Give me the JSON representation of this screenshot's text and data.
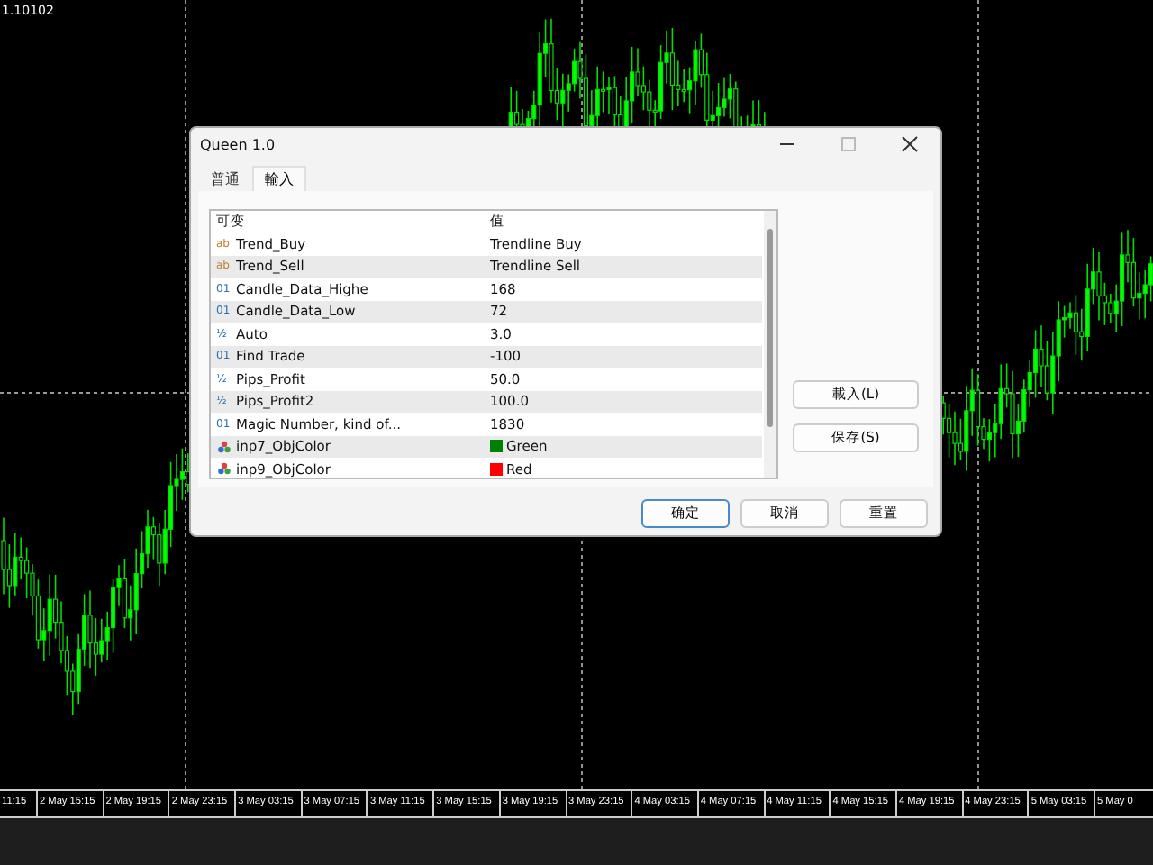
{
  "chart": {
    "price_label": "1.10102",
    "time_axis": [
      "11:15",
      "2 May 15:15",
      "2 May 19:15",
      "2 May 23:15",
      "3 May 03:15",
      "3 May 07:15",
      "3 May 11:15",
      "3 May 15:15",
      "3 May 19:15",
      "3 May 23:15",
      "4 May 03:15",
      "4 May 07:15",
      "4 May 11:15",
      "4 May 15:15",
      "4 May 19:15",
      "4 May 23:15",
      "5 May 03:15",
      "5 May 0"
    ]
  },
  "dialog": {
    "title": "Queen  1.0",
    "tabs": [
      {
        "label": "普通",
        "selected": false
      },
      {
        "label": "輸入",
        "selected": true
      }
    ],
    "table": {
      "columns": [
        "可变",
        "值"
      ],
      "rows": [
        {
          "kind": "string",
          "type_icon": "ab",
          "name": "Trend_Buy",
          "value": "Trendline Buy"
        },
        {
          "kind": "string",
          "type_icon": "ab",
          "name": "Trend_Sell",
          "value": "Trendline Sell"
        },
        {
          "kind": "int",
          "type_icon": "01",
          "name": "Candle_Data_Highe",
          "value": "168"
        },
        {
          "kind": "int",
          "type_icon": "01",
          "name": "Candle_Data_Low",
          "value": "72"
        },
        {
          "kind": "double",
          "type_icon": "½",
          "name": "Auto",
          "value": "3.0"
        },
        {
          "kind": "int",
          "type_icon": "01",
          "name": "Find Trade",
          "value": "-100"
        },
        {
          "kind": "double",
          "type_icon": "½",
          "name": "Pips_Profit",
          "value": "50.0"
        },
        {
          "kind": "double",
          "type_icon": "½",
          "name": "Pips_Profit2",
          "value": "100.0"
        },
        {
          "kind": "int",
          "type_icon": "01",
          "name": "Magic Number, kind of...",
          "value": "1830"
        },
        {
          "kind": "color",
          "name": "inp7_ObjColor",
          "value": "Green",
          "color": "#008000"
        },
        {
          "kind": "color",
          "name": "inp9_ObjColor",
          "value": "Red",
          "color": "#ff0000"
        }
      ]
    },
    "side_buttons": [
      "載入(L)",
      "保存(S)"
    ],
    "buttons": [
      {
        "label": "确定",
        "default": true
      },
      {
        "label": "取消",
        "default": false
      },
      {
        "label": "重置",
        "default": false
      }
    ]
  }
}
